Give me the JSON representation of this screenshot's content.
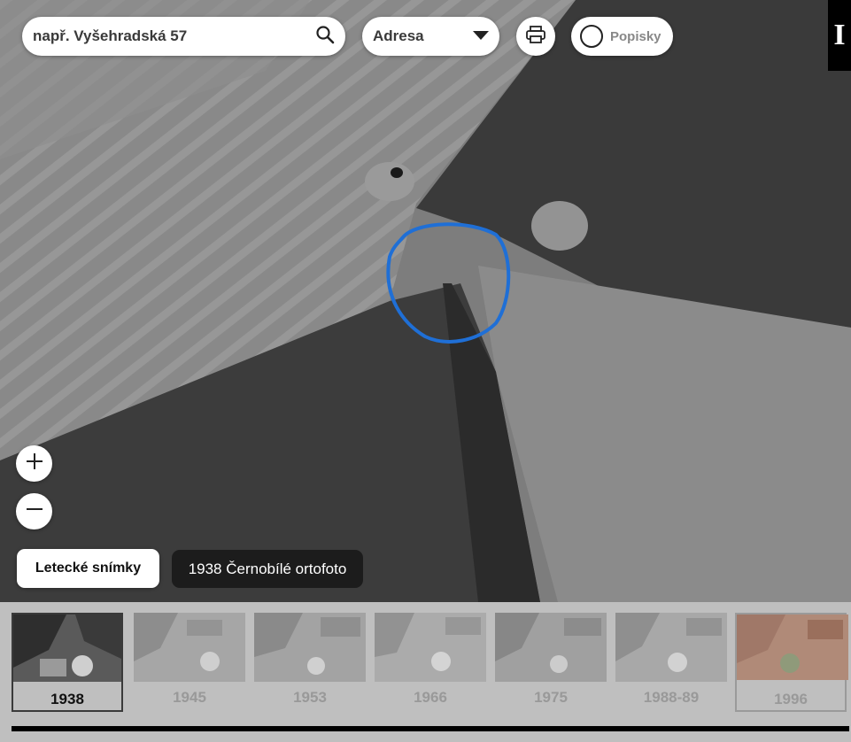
{
  "search": {
    "placeholder": "např. Vyšehradská 57"
  },
  "search_mode": {
    "selected": "Adresa"
  },
  "toggles": {
    "labels": "Popisky"
  },
  "logo": {
    "letter": "I"
  },
  "layer": {
    "button_label": "Letecké snímky",
    "current": "1938 Černobílé ortofoto"
  },
  "timeline": {
    "years": [
      {
        "label": "1938",
        "active": true
      },
      {
        "label": "1945",
        "active": false
      },
      {
        "label": "1953",
        "active": false
      },
      {
        "label": "1966",
        "active": false
      },
      {
        "label": "1975",
        "active": false
      },
      {
        "label": "1988-89",
        "active": false
      },
      {
        "label": "1996",
        "active": false
      }
    ]
  },
  "colors": {
    "marker": "#1f6fd6",
    "tag_bg": "#1c1c1c",
    "timeline_bg": "#c4c4c4"
  },
  "icons": [
    "search-icon",
    "dropdown-arrow-icon",
    "printer-icon",
    "radio-circle-icon",
    "plus-icon",
    "minus-icon"
  ]
}
